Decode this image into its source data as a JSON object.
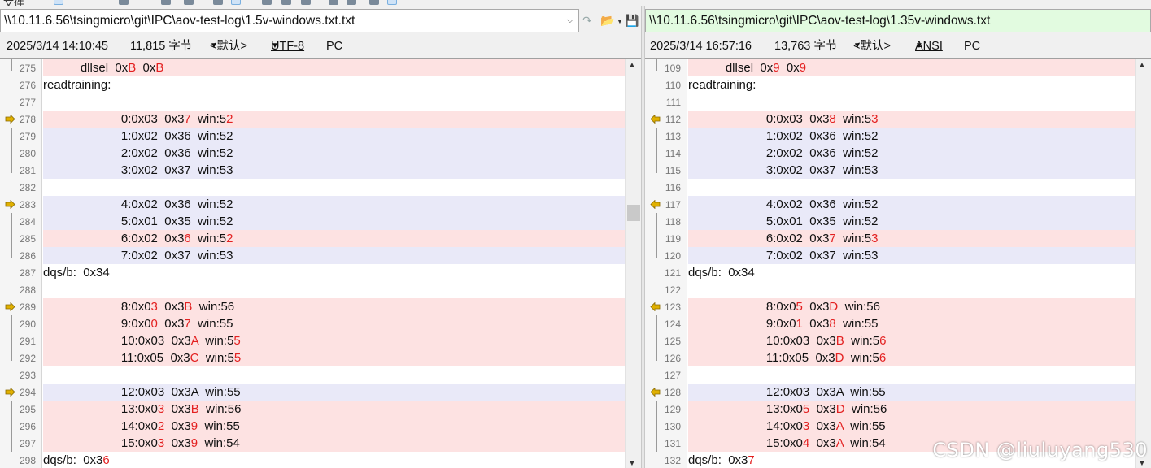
{
  "toolbar": {
    "left_fragment": "文件",
    "icons": [
      "select-icon",
      "copy-icon",
      "compare-icon",
      "settings-icon",
      "arrow-icon",
      "edit-icon",
      "pin-icon",
      "mark-icon",
      "grid-icon",
      "refresh-icon",
      "open-icon",
      "page-icon",
      "view-icon"
    ]
  },
  "left_pane": {
    "path": "\\\\10.11.6.56\\tsingmicro\\git\\IPC\\aov-test-log\\1.5v-windows.txt.txt",
    "status": {
      "date": "2025/3/14 14:10:45",
      "size": "11,815 字节",
      "format": "<默认>",
      "encoding": "UTF-8",
      "line_ending": "PC"
    },
    "lines": [
      {
        "n": "275",
        "bg": "diff",
        "mark": "bar-end",
        "segs": [
          [
            "           dllsel  0x",
            ""
          ],
          [
            "B",
            "d"
          ],
          [
            "  0x",
            ""
          ],
          [
            "B",
            "d"
          ]
        ]
      },
      {
        "n": "276",
        "bg": "none",
        "mark": "",
        "segs": [
          [
            "readtraining:",
            ""
          ]
        ]
      },
      {
        "n": "277",
        "bg": "none",
        "mark": "",
        "segs": [
          [
            "",
            ""
          ]
        ]
      },
      {
        "n": "278",
        "bg": "diff",
        "mark": "arrow-right",
        "segs": [
          [
            "                       0:0x03  0x3",
            ""
          ],
          [
            "7",
            "d"
          ],
          [
            "  win:5",
            ""
          ],
          [
            "2",
            "d"
          ]
        ]
      },
      {
        "n": "279",
        "bg": "mod",
        "mark": "bar",
        "segs": [
          [
            "                       1:0x02  0x36  win:52",
            ""
          ]
        ]
      },
      {
        "n": "280",
        "bg": "mod",
        "mark": "bar",
        "segs": [
          [
            "                       2:0x02  0x36  win:52",
            ""
          ]
        ]
      },
      {
        "n": "281",
        "bg": "mod",
        "mark": "bar-end",
        "segs": [
          [
            "                       3:0x02  0x37  win:53",
            ""
          ]
        ]
      },
      {
        "n": "282",
        "bg": "none",
        "mark": "",
        "segs": [
          [
            "",
            ""
          ]
        ]
      },
      {
        "n": "283",
        "bg": "mod",
        "mark": "arrow-right",
        "segs": [
          [
            "                       4:0x02  0x36  win:52",
            ""
          ]
        ]
      },
      {
        "n": "284",
        "bg": "mod",
        "mark": "bar",
        "segs": [
          [
            "                       5:0x01  0x35  win:52",
            ""
          ]
        ]
      },
      {
        "n": "285",
        "bg": "diff",
        "mark": "bar",
        "segs": [
          [
            "                       6:0x02  0x3",
            ""
          ],
          [
            "6",
            "d"
          ],
          [
            "  win:5",
            ""
          ],
          [
            "2",
            "d"
          ]
        ]
      },
      {
        "n": "286",
        "bg": "mod",
        "mark": "bar-end",
        "segs": [
          [
            "                       7:0x02  0x37  win:53",
            ""
          ]
        ]
      },
      {
        "n": "287",
        "bg": "none",
        "mark": "",
        "segs": [
          [
            "dqs/b:  0x34",
            ""
          ]
        ]
      },
      {
        "n": "288",
        "bg": "none",
        "mark": "",
        "segs": [
          [
            "",
            ""
          ]
        ]
      },
      {
        "n": "289",
        "bg": "diff",
        "mark": "arrow-right",
        "segs": [
          [
            "                       8:0x0",
            ""
          ],
          [
            "3",
            "d"
          ],
          [
            "  0x3",
            ""
          ],
          [
            "B",
            "d"
          ],
          [
            "  win:56",
            ""
          ]
        ]
      },
      {
        "n": "290",
        "bg": "diff",
        "mark": "bar",
        "segs": [
          [
            "                       9:0x0",
            ""
          ],
          [
            "0",
            "d"
          ],
          [
            "  0x3",
            ""
          ],
          [
            "7",
            "d"
          ],
          [
            "  win:55",
            ""
          ]
        ]
      },
      {
        "n": "291",
        "bg": "diff",
        "mark": "bar",
        "segs": [
          [
            "                       10:0x03  0x3",
            ""
          ],
          [
            "A",
            "d"
          ],
          [
            "  win:5",
            ""
          ],
          [
            "5",
            "d"
          ]
        ]
      },
      {
        "n": "292",
        "bg": "diff",
        "mark": "bar-end",
        "segs": [
          [
            "                       11:0x05  0x3",
            ""
          ],
          [
            "C",
            "d"
          ],
          [
            "  win:5",
            ""
          ],
          [
            "5",
            "d"
          ]
        ]
      },
      {
        "n": "293",
        "bg": "none",
        "mark": "",
        "segs": [
          [
            "",
            ""
          ]
        ]
      },
      {
        "n": "294",
        "bg": "mod",
        "mark": "arrow-right",
        "segs": [
          [
            "                       12:0x03  0x3A  win:55",
            ""
          ]
        ]
      },
      {
        "n": "295",
        "bg": "diff",
        "mark": "bar",
        "segs": [
          [
            "                       13:0x0",
            ""
          ],
          [
            "3",
            "d"
          ],
          [
            "  0x3",
            ""
          ],
          [
            "B",
            "d"
          ],
          [
            "  win:56",
            ""
          ]
        ]
      },
      {
        "n": "296",
        "bg": "diff",
        "mark": "bar",
        "segs": [
          [
            "                       14:0x0",
            ""
          ],
          [
            "2",
            "d"
          ],
          [
            "  0x3",
            ""
          ],
          [
            "9",
            "d"
          ],
          [
            "  win:55",
            ""
          ]
        ]
      },
      {
        "n": "297",
        "bg": "diff",
        "mark": "bar",
        "segs": [
          [
            "                       15:0x0",
            ""
          ],
          [
            "3",
            "d"
          ],
          [
            "  0x3",
            ""
          ],
          [
            "9",
            "d"
          ],
          [
            "  win:54",
            ""
          ]
        ]
      },
      {
        "n": "298",
        "bg": "none",
        "mark": "",
        "segs": [
          [
            "dqs/b:  0x3",
            ""
          ],
          [
            "6",
            "d"
          ]
        ]
      }
    ]
  },
  "right_pane": {
    "path": "\\\\10.11.6.56\\tsingmicro\\git\\IPC\\aov-test-log\\1.35v-windows.txt",
    "status": {
      "date": "2025/3/14 16:57:16",
      "size": "13,763 字节",
      "format": "<默认>",
      "encoding": "ANSI",
      "line_ending": "PC"
    },
    "lines": [
      {
        "n": "109",
        "bg": "diff",
        "mark": "bar-end",
        "segs": [
          [
            "           dllsel  0x",
            ""
          ],
          [
            "9",
            "d"
          ],
          [
            "  0x",
            ""
          ],
          [
            "9",
            "d"
          ]
        ]
      },
      {
        "n": "110",
        "bg": "none",
        "mark": "",
        "segs": [
          [
            "readtraining:",
            ""
          ]
        ]
      },
      {
        "n": "111",
        "bg": "none",
        "mark": "",
        "segs": [
          [
            "",
            ""
          ]
        ]
      },
      {
        "n": "112",
        "bg": "diff",
        "mark": "arrow-left",
        "segs": [
          [
            "                       0:0x03  0x3",
            ""
          ],
          [
            "8",
            "d"
          ],
          [
            "  win:5",
            ""
          ],
          [
            "3",
            "d"
          ]
        ]
      },
      {
        "n": "113",
        "bg": "mod",
        "mark": "bar",
        "segs": [
          [
            "                       1:0x02  0x36  win:52",
            ""
          ]
        ]
      },
      {
        "n": "114",
        "bg": "mod",
        "mark": "bar",
        "segs": [
          [
            "                       2:0x02  0x36  win:52",
            ""
          ]
        ]
      },
      {
        "n": "115",
        "bg": "mod",
        "mark": "bar-end",
        "segs": [
          [
            "                       3:0x02  0x37  win:53",
            ""
          ]
        ]
      },
      {
        "n": "116",
        "bg": "none",
        "mark": "",
        "segs": [
          [
            "",
            ""
          ]
        ]
      },
      {
        "n": "117",
        "bg": "mod",
        "mark": "arrow-left",
        "segs": [
          [
            "                       4:0x02  0x36  win:52",
            ""
          ]
        ]
      },
      {
        "n": "118",
        "bg": "mod",
        "mark": "bar",
        "segs": [
          [
            "                       5:0x01  0x35  win:52",
            ""
          ]
        ]
      },
      {
        "n": "119",
        "bg": "diff",
        "mark": "bar",
        "segs": [
          [
            "                       6:0x02  0x3",
            ""
          ],
          [
            "7",
            "d"
          ],
          [
            "  win:5",
            ""
          ],
          [
            "3",
            "d"
          ]
        ]
      },
      {
        "n": "120",
        "bg": "mod",
        "mark": "bar-end",
        "segs": [
          [
            "                       7:0x02  0x37  win:53",
            ""
          ]
        ]
      },
      {
        "n": "121",
        "bg": "none",
        "mark": "",
        "segs": [
          [
            "dqs/b:  0x34",
            ""
          ]
        ]
      },
      {
        "n": "122",
        "bg": "none",
        "mark": "",
        "segs": [
          [
            "",
            ""
          ]
        ]
      },
      {
        "n": "123",
        "bg": "diff",
        "mark": "arrow-left",
        "segs": [
          [
            "                       8:0x0",
            ""
          ],
          [
            "5",
            "d"
          ],
          [
            "  0x3",
            ""
          ],
          [
            "D",
            "d"
          ],
          [
            "  win:56",
            ""
          ]
        ]
      },
      {
        "n": "124",
        "bg": "diff",
        "mark": "bar",
        "segs": [
          [
            "                       9:0x0",
            ""
          ],
          [
            "1",
            "d"
          ],
          [
            "  0x3",
            ""
          ],
          [
            "8",
            "d"
          ],
          [
            "  win:55",
            ""
          ]
        ]
      },
      {
        "n": "125",
        "bg": "diff",
        "mark": "bar",
        "segs": [
          [
            "                       10:0x03  0x3",
            ""
          ],
          [
            "B",
            "d"
          ],
          [
            "  win:5",
            ""
          ],
          [
            "6",
            "d"
          ]
        ]
      },
      {
        "n": "126",
        "bg": "diff",
        "mark": "bar-end",
        "segs": [
          [
            "                       11:0x05  0x3",
            ""
          ],
          [
            "D",
            "d"
          ],
          [
            "  win:5",
            ""
          ],
          [
            "6",
            "d"
          ]
        ]
      },
      {
        "n": "127",
        "bg": "none",
        "mark": "",
        "segs": [
          [
            "",
            ""
          ]
        ]
      },
      {
        "n": "128",
        "bg": "mod",
        "mark": "arrow-left",
        "segs": [
          [
            "                       12:0x03  0x3A  win:55",
            ""
          ]
        ]
      },
      {
        "n": "129",
        "bg": "diff",
        "mark": "bar",
        "segs": [
          [
            "                       13:0x0",
            ""
          ],
          [
            "5",
            "d"
          ],
          [
            "  0x3",
            ""
          ],
          [
            "D",
            "d"
          ],
          [
            "  win:56",
            ""
          ]
        ]
      },
      {
        "n": "130",
        "bg": "diff",
        "mark": "bar",
        "segs": [
          [
            "                       14:0x0",
            ""
          ],
          [
            "3",
            "d"
          ],
          [
            "  0x3",
            ""
          ],
          [
            "A",
            "d"
          ],
          [
            "  win:55",
            ""
          ]
        ]
      },
      {
        "n": "131",
        "bg": "diff",
        "mark": "bar",
        "segs": [
          [
            "                       15:0x0",
            ""
          ],
          [
            "4",
            "d"
          ],
          [
            "  0x3",
            ""
          ],
          [
            "A",
            "d"
          ],
          [
            "  win:54",
            ""
          ]
        ]
      },
      {
        "n": "132",
        "bg": "none",
        "mark": "",
        "segs": [
          [
            "dqs/b:  0x3",
            ""
          ],
          [
            "7",
            "d"
          ]
        ]
      }
    ]
  },
  "colors": {
    "diff_bg": "#fde2e2",
    "mod_bg": "#e9e9f8",
    "diff_text": "#e32020",
    "right_path_bg": "#e2fbe0",
    "arrow": "#e0b000"
  },
  "watermark": "CSDN @liuluyang530"
}
